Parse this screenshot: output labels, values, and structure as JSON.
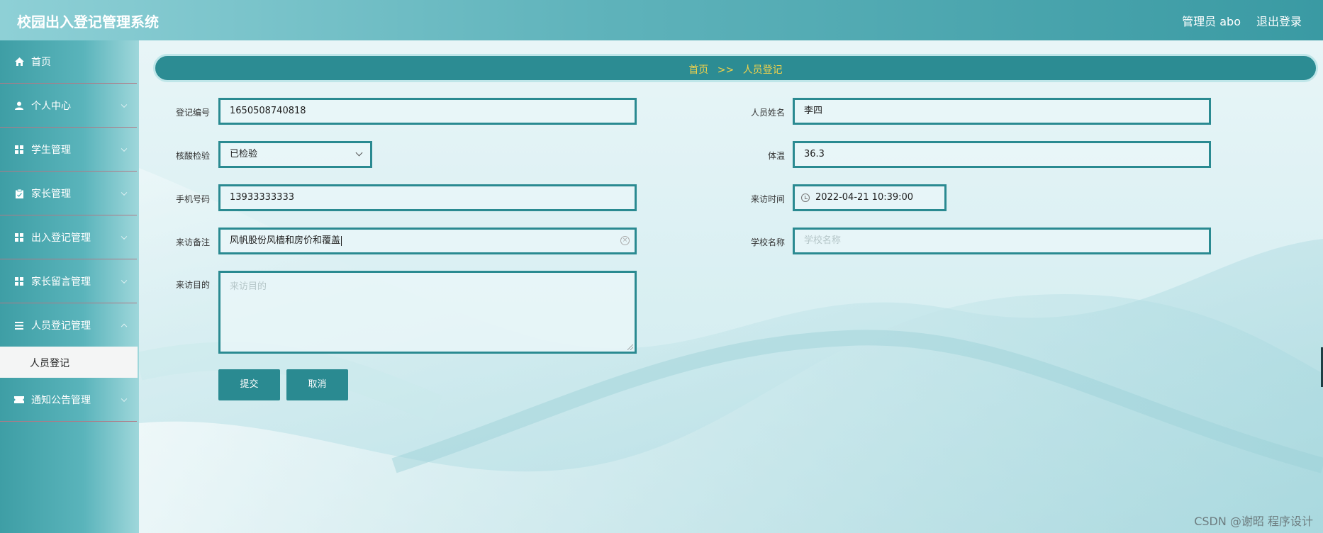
{
  "header": {
    "app_title": "校园出入登记管理系统",
    "user_label": "管理员 abo",
    "logout_label": "退出登录"
  },
  "sidebar": {
    "items": [
      {
        "label": "首页",
        "icon": "home-icon",
        "has_arrow": false
      },
      {
        "label": "个人中心",
        "icon": "user-icon",
        "has_arrow": true
      },
      {
        "label": "学生管理",
        "icon": "grid-icon",
        "has_arrow": true
      },
      {
        "label": "家长管理",
        "icon": "clipboard-icon",
        "has_arrow": true
      },
      {
        "label": "出入登记管理",
        "icon": "grid-icon",
        "has_arrow": true
      },
      {
        "label": "家长留言管理",
        "icon": "grid-icon",
        "has_arrow": true
      },
      {
        "label": "人员登记管理",
        "icon": "list-icon",
        "has_arrow": true
      },
      {
        "label": "通知公告管理",
        "icon": "ticket-icon",
        "has_arrow": true
      }
    ],
    "submenu": {
      "label": "人员登记"
    }
  },
  "breadcrumb": {
    "home": "首页",
    "separator": ">>",
    "current": "人员登记"
  },
  "form": {
    "reg_no_label": "登记编号",
    "reg_no_value": "1650508740818",
    "name_label": "人员姓名",
    "name_value": "李四",
    "nucleic_label": "核酸检验",
    "nucleic_value": "已检验",
    "temp_label": "体温",
    "temp_value": "36.3",
    "phone_label": "手机号码",
    "phone_value": "13933333333",
    "visit_time_label": "来访时间",
    "visit_time_value": "2022-04-21 10:39:00",
    "remark_label": "来访备注",
    "remark_value": "风帆股份风樯和房价和覆盖",
    "school_label": "学校名称",
    "school_placeholder": "学校名称",
    "purpose_label": "来访目的",
    "purpose_placeholder": "来访目的",
    "submit_label": "提交",
    "cancel_label": "取消"
  },
  "watermark": "CSDN @谢昭 程序设计",
  "colors": {
    "accent": "#2a8a91",
    "breadcrumb_text": "#f2d24a",
    "header_start": "#8ed0d6",
    "header_end": "#3a9aa3"
  }
}
